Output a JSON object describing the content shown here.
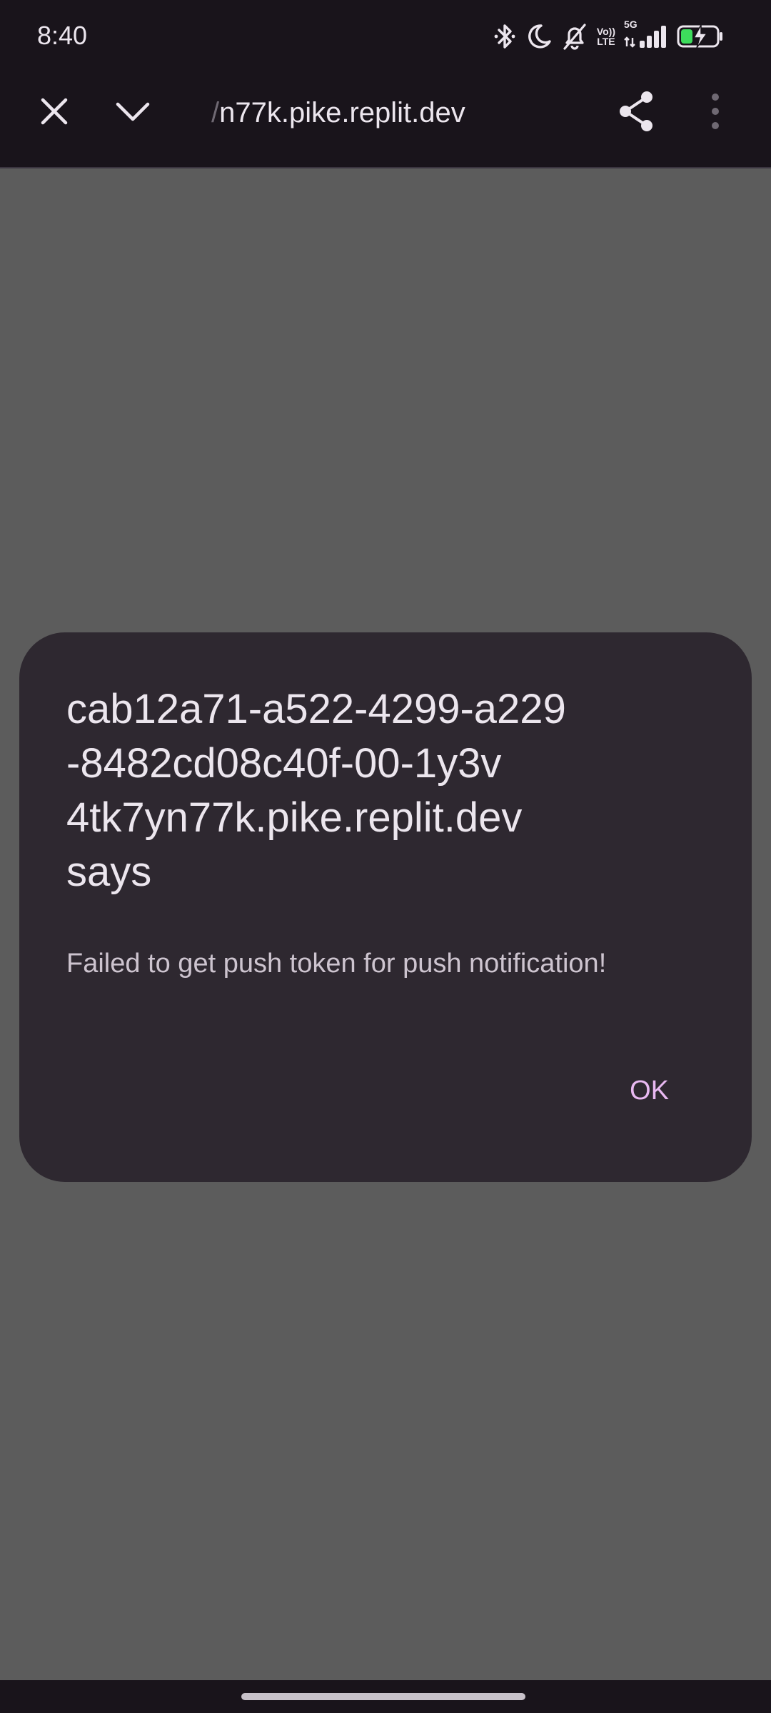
{
  "status_bar": {
    "time": "8:40",
    "icons": [
      "bluetooth-icon",
      "do-not-disturb-moon-icon",
      "bell-off-icon",
      "volte-icon",
      "5g-signal-icon",
      "battery-charging-icon"
    ],
    "volte_top": "Vo))",
    "volte_bottom": "LTE",
    "network_label": "5G",
    "battery_color": "#3ddc5c"
  },
  "toolbar": {
    "url_fade": "/",
    "url": "n77k.pike.replit.dev",
    "icons": [
      "close-icon",
      "chevron-down-icon",
      "share-icon",
      "more-vert-icon"
    ]
  },
  "dialog": {
    "title": "cab12a71-a522-4299-a229\n-8482cd08c40f-00-1y3v\n4tk7yn77k.pike.replit.dev\nsays",
    "message": "Failed to get push token for push notification!",
    "ok_label": "OK",
    "accent_color": "#e9b9f2"
  }
}
